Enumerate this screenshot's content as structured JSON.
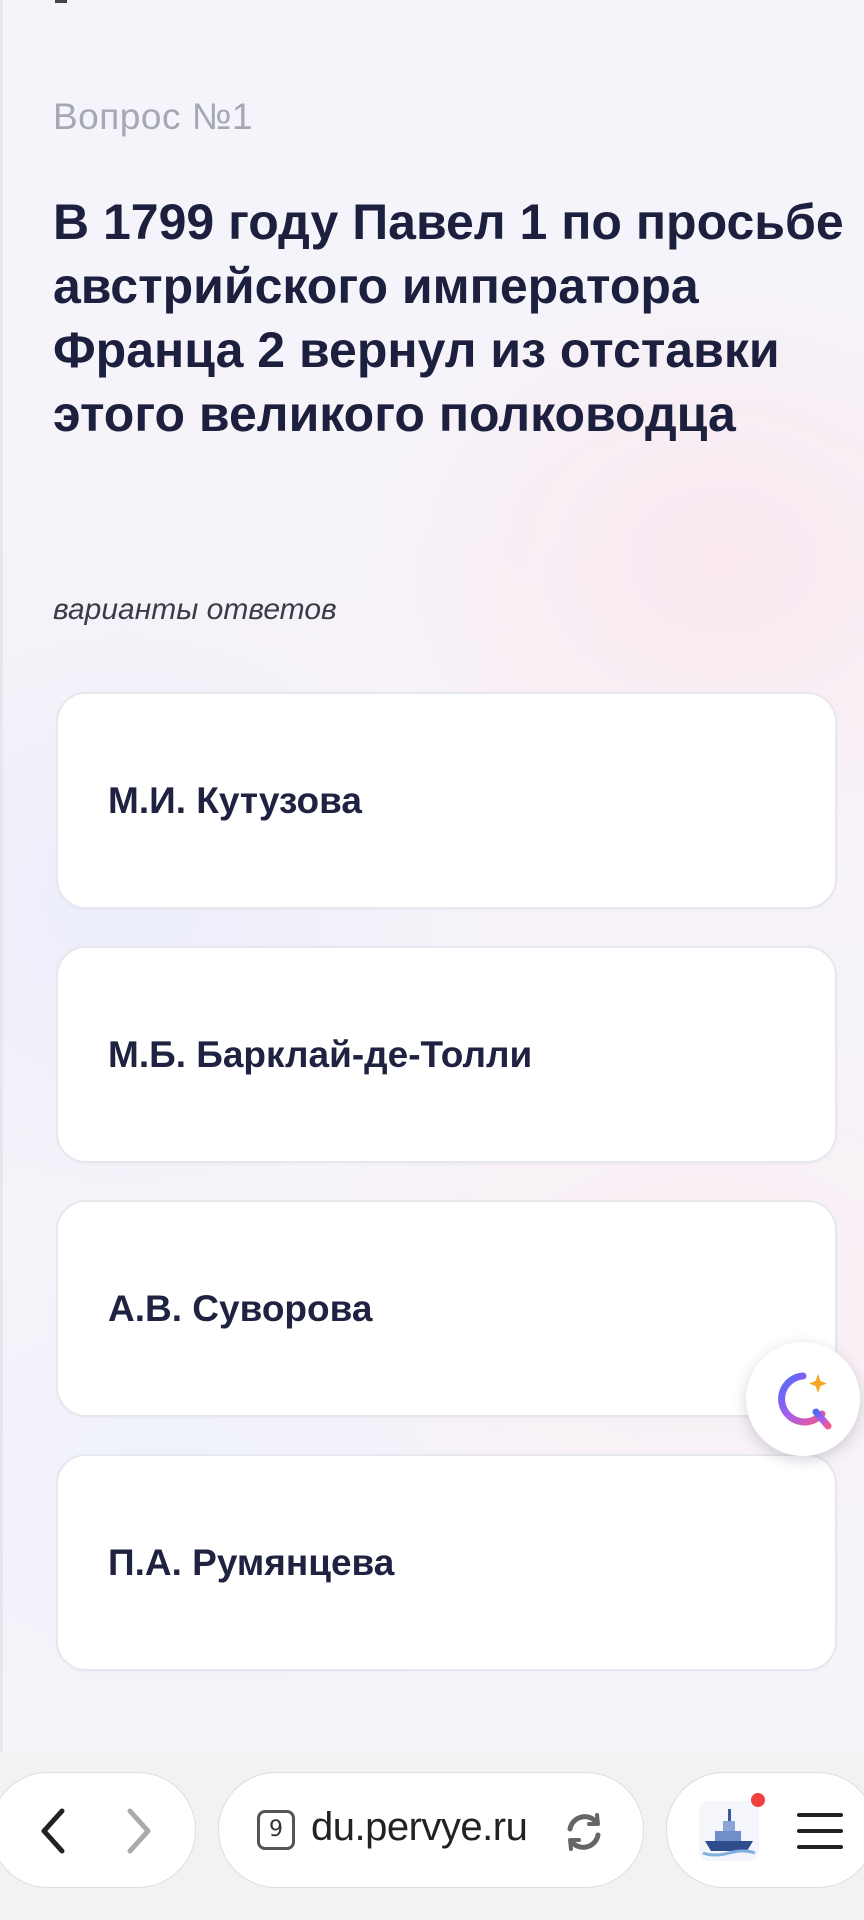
{
  "quiz": {
    "question_number": "Вопрос №1",
    "question_text": "В 1799 году Павел 1 по просьбе австрийского императора Франца 2 вернул из отставки этого великого полководца",
    "answers_label": "варианты ответов",
    "answers": [
      {
        "label": "М.И. Кутузова"
      },
      {
        "label": "М.Б. Барклай-де-Толли"
      },
      {
        "label": "А.В. Суворова"
      },
      {
        "label": "П.А. Румянцева"
      }
    ]
  },
  "assistant": {
    "icon": "alice-assistant-icon"
  },
  "browser": {
    "url": "du.pervye.ru",
    "tab_count": "9",
    "icons": {
      "back": "chevron-left-icon",
      "forward": "chevron-right-icon",
      "reload": "reload-icon",
      "site": "ship-icon",
      "menu": "hamburger-menu-icon"
    },
    "colors": {
      "notification_dot": "#f04040",
      "title_text": "#1c1f3d",
      "muted_text": "#a6a8b3"
    }
  }
}
